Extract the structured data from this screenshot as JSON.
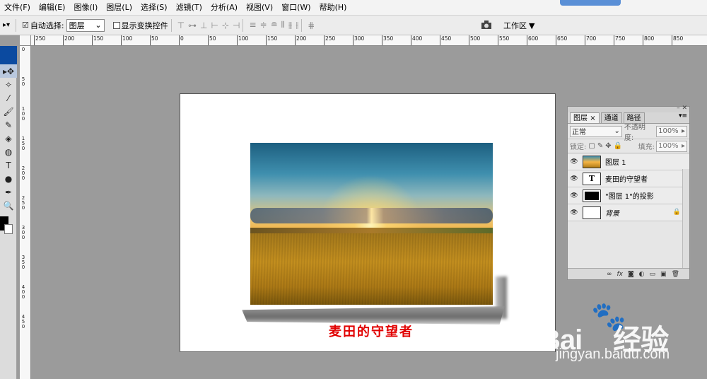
{
  "menu": {
    "items": [
      "文件(F)",
      "编辑(E)",
      "图像(I)",
      "图层(L)",
      "选择(S)",
      "滤镜(T)",
      "分析(A)",
      "视图(V)",
      "窗口(W)",
      "帮助(H)"
    ]
  },
  "options_bar": {
    "auto_select_label": "自动选择:",
    "auto_select_checked": "☑",
    "auto_select_value": "图层",
    "show_transform_label": "显示变换控件",
    "workspace_label": "工作区",
    "workspace_arrow": "▼"
  },
  "ruler_top_labels": [
    "250",
    "200",
    "150",
    "100",
    "50",
    "0",
    "50",
    "100",
    "150",
    "200",
    "250",
    "300",
    "350",
    "400",
    "450",
    "500",
    "550",
    "600",
    "650",
    "700",
    "750",
    "800",
    "850"
  ],
  "ruler_left_labels": [
    "0",
    "50",
    "100",
    "150",
    "200",
    "250",
    "300",
    "350",
    "400",
    "450"
  ],
  "toolbox": {
    "tools": [
      "move-tool",
      "magic-wand-tool",
      "eyedropper-tool",
      "brush-tool",
      "history-brush-tool",
      "paint-bucket-tool",
      "smudge-tool",
      "type-tool",
      "ellipse-tool",
      "pen-tool",
      "zoom-tool"
    ],
    "tool_glyphs": [
      "▸✥",
      "✧",
      "⁄",
      "🖌",
      "✎",
      "◈",
      "◍",
      "T",
      "●",
      "✒",
      "🔍"
    ]
  },
  "canvas": {
    "caption": "麦田的守望者"
  },
  "layers_panel": {
    "tabs": [
      "图层",
      "通道",
      "路径"
    ],
    "tab_close": "×",
    "blend_mode": "正常",
    "opacity_label": "不透明度:",
    "opacity_value": "100%",
    "lock_label": "锁定:",
    "fill_label": "填充:",
    "fill_value": "100%",
    "layers": [
      {
        "name": "图层 1",
        "thumb": ""
      },
      {
        "name": "麦田的守望者",
        "thumb": "T"
      },
      {
        "name": "\"图层 1\"的投影",
        "thumb": ""
      },
      {
        "name": "背景",
        "thumb": ""
      }
    ],
    "footer_icons": [
      "link-icon",
      "fx-icon",
      "mask-icon",
      "adjustment-icon",
      "folder-icon",
      "new-layer-icon",
      "trash-icon"
    ],
    "footer_glyphs": [
      "∞",
      "fx",
      "◙",
      "◐",
      "▭",
      "▣",
      "🗑"
    ]
  },
  "watermark": {
    "main": "Bai",
    "brand_cn": "经验",
    "url": "jingyan.baidu.com"
  },
  "colors": {
    "caption_red": "#e10000",
    "toolbox_header": "#0b4aa0",
    "canvas_bg": "#9b9b9b"
  }
}
